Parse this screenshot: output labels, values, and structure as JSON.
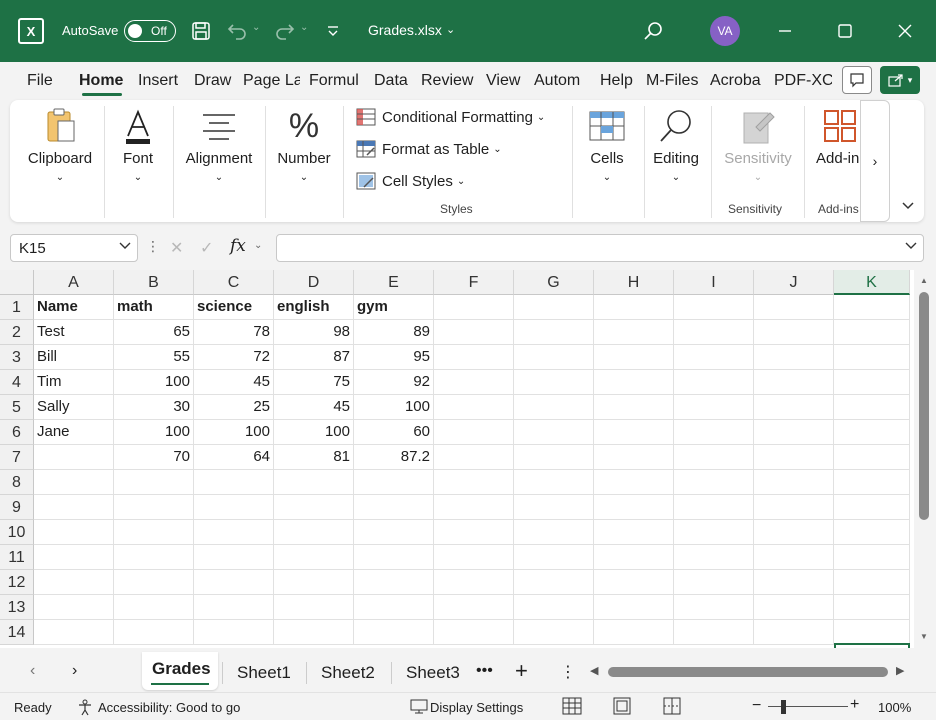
{
  "titlebar": {
    "logo": "X",
    "autosave_label": "AutoSave",
    "autosave_state": "Off",
    "doc_title": "Grades.xlsx",
    "avatar": "VA"
  },
  "ribbon_tabs": [
    "File",
    "Home",
    "Insert",
    "Draw",
    "Page La",
    "Formul",
    "Data",
    "Review",
    "View",
    "Autom",
    "Help",
    "M-Files",
    "Acroba",
    "PDF-XC"
  ],
  "ribbon": {
    "clipboard": "Clipboard",
    "font": "Font",
    "alignment": "Alignment",
    "number": "Number",
    "conditional_formatting": "Conditional Formatting",
    "format_as_table": "Format as Table",
    "cell_styles": "Cell Styles",
    "styles_group": "Styles",
    "cells": "Cells",
    "editing": "Editing",
    "sensitivity": "Sensitivity",
    "sensitivity_group": "Sensitivity",
    "addins": "Add-in",
    "addins_group": "Add-ins",
    "overflow": "›"
  },
  "formula_bar": {
    "name_box": "K15",
    "fx": "fx",
    "value": ""
  },
  "columns": [
    "A",
    "B",
    "C",
    "D",
    "E",
    "F",
    "G",
    "H",
    "I",
    "J",
    "K"
  ],
  "selected_column": "K",
  "rows": [
    "1",
    "2",
    "3",
    "4",
    "5",
    "6",
    "7",
    "8",
    "9",
    "10",
    "11",
    "12",
    "13",
    "14"
  ],
  "cells": [
    [
      "Name",
      "math",
      "science",
      "english",
      "gym"
    ],
    [
      "Test",
      "65",
      "78",
      "98",
      "89"
    ],
    [
      "Bill",
      "55",
      "72",
      "87",
      "95"
    ],
    [
      "Tim",
      "100",
      "45",
      "75",
      "92"
    ],
    [
      "Sally",
      "30",
      "25",
      "45",
      "100"
    ],
    [
      "Jane",
      "100",
      "100",
      "100",
      "60"
    ],
    [
      "",
      "70",
      "64",
      "81",
      "87.2"
    ]
  ],
  "sheets": [
    "Grades",
    "Sheet1",
    "Sheet2",
    "Sheet3"
  ],
  "active_sheet": "Grades",
  "status": {
    "ready": "Ready",
    "accessibility": "Accessibility: Good to go",
    "display_settings": "Display Settings",
    "zoom": "100%"
  },
  "colors": {
    "brand": "#1e7145",
    "avatar": "#8661c5"
  }
}
